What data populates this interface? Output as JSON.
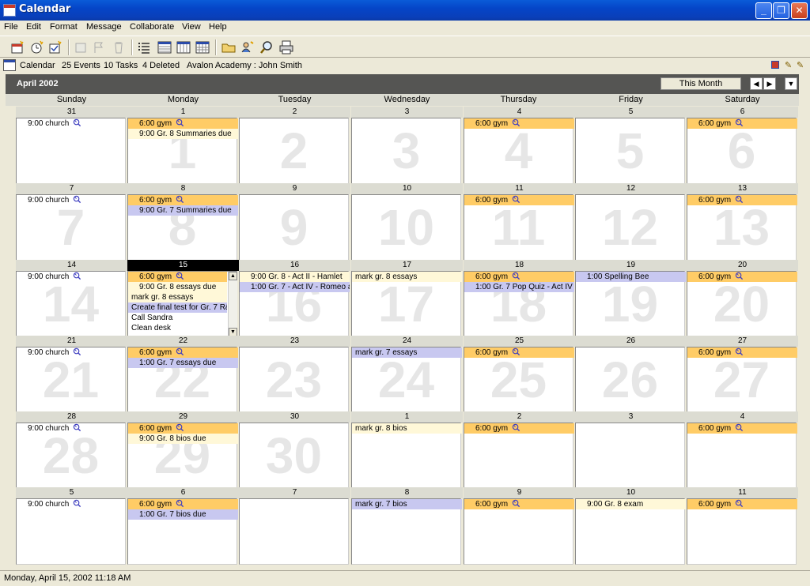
{
  "window": {
    "title": "Calendar",
    "min": "_",
    "max": "❐",
    "close": "✕"
  },
  "menu": [
    "File",
    "Edit",
    "Format",
    "Message",
    "Collaborate",
    "View",
    "Help"
  ],
  "info": {
    "label": "Calendar",
    "events": "25 Events",
    "tasks": "10 Tasks",
    "deleted": "4 Deleted",
    "account": "Avalon Academy : John Smith"
  },
  "month": {
    "title": "April 2002",
    "this_month": "This Month",
    "prev": "◀",
    "next": "▶",
    "dropdown": "▼"
  },
  "day_names": [
    "Sunday",
    "Monday",
    "Tuesday",
    "Wednesday",
    "Thursday",
    "Friday",
    "Saturday"
  ],
  "weeks": [
    [
      {
        "d": "31",
        "big": "",
        "events": [
          {
            "t": "9:00 church",
            "c": "plain",
            "r": true
          }
        ]
      },
      {
        "d": "1",
        "big": "1",
        "events": [
          {
            "t": "6:00 gym",
            "c": "orange",
            "r": true
          },
          {
            "t": "9:00 Gr. 8 Summaries due",
            "c": "yellow"
          }
        ]
      },
      {
        "d": "2",
        "big": "2",
        "events": []
      },
      {
        "d": "3",
        "big": "3",
        "events": []
      },
      {
        "d": "4",
        "big": "4",
        "events": [
          {
            "t": "6:00 gym",
            "c": "orange",
            "r": true
          }
        ]
      },
      {
        "d": "5",
        "big": "5",
        "events": []
      },
      {
        "d": "6",
        "big": "6",
        "events": [
          {
            "t": "6:00 gym",
            "c": "orange",
            "r": true
          }
        ]
      }
    ],
    [
      {
        "d": "7",
        "big": "7",
        "events": [
          {
            "t": "9:00 church",
            "c": "plain",
            "r": true
          }
        ]
      },
      {
        "d": "8",
        "big": "8",
        "events": [
          {
            "t": "6:00 gym",
            "c": "orange",
            "r": true
          },
          {
            "t": "9:00 Gr. 7 Summaries due",
            "c": "purple"
          }
        ]
      },
      {
        "d": "9",
        "big": "9",
        "events": []
      },
      {
        "d": "10",
        "big": "10",
        "events": []
      },
      {
        "d": "11",
        "big": "11",
        "events": [
          {
            "t": "6:00 gym",
            "c": "orange",
            "r": true
          }
        ]
      },
      {
        "d": "12",
        "big": "12",
        "events": []
      },
      {
        "d": "13",
        "big": "13",
        "events": [
          {
            "t": "6:00 gym",
            "c": "orange",
            "r": true
          }
        ]
      }
    ],
    [
      {
        "d": "14",
        "big": "14",
        "events": [
          {
            "t": "9:00 church",
            "c": "plain",
            "r": true
          }
        ]
      },
      {
        "d": "15",
        "big": "",
        "today": true,
        "scroll": true,
        "events": [
          {
            "t": "6:00 gym",
            "c": "orange",
            "r": true
          },
          {
            "t": "9:00 Gr. 8 essays due",
            "c": "yellow"
          },
          {
            "t": "mark gr. 8 essays",
            "c": "yellow",
            "np": true
          },
          {
            "t": "Create final test for Gr. 7 R&",
            "c": "purple",
            "np": true
          },
          {
            "t": "Call Sandra",
            "c": "plain",
            "np": true
          },
          {
            "t": "Clean desk",
            "c": "plain",
            "np": true
          }
        ]
      },
      {
        "d": "16",
        "big": "16",
        "events": [
          {
            "t": "9:00 Gr. 8 - Act II - Hamlet",
            "c": "yellow"
          },
          {
            "t": "1:00 Gr. 7 - Act IV - Romeo a",
            "c": "purple"
          }
        ]
      },
      {
        "d": "17",
        "big": "17",
        "events": [
          {
            "t": "mark gr. 8 essays",
            "c": "yellow",
            "np": true
          }
        ]
      },
      {
        "d": "18",
        "big": "18",
        "events": [
          {
            "t": "6:00 gym",
            "c": "orange",
            "r": true
          },
          {
            "t": "1:00 Gr. 7 Pop Quiz - Act IV -",
            "c": "purple"
          }
        ]
      },
      {
        "d": "19",
        "big": "19",
        "events": [
          {
            "t": "1:00 Spelling Bee",
            "c": "purple"
          }
        ]
      },
      {
        "d": "20",
        "big": "20",
        "events": [
          {
            "t": "6:00 gym",
            "c": "orange",
            "r": true
          }
        ]
      }
    ],
    [
      {
        "d": "21",
        "big": "21",
        "events": [
          {
            "t": "9:00 church",
            "c": "plain",
            "r": true
          }
        ]
      },
      {
        "d": "22",
        "big": "22",
        "events": [
          {
            "t": "6:00 gym",
            "c": "orange",
            "r": true
          },
          {
            "t": "1:00 Gr. 7 essays due",
            "c": "purple"
          }
        ]
      },
      {
        "d": "23",
        "big": "23",
        "events": []
      },
      {
        "d": "24",
        "big": "24",
        "events": [
          {
            "t": "mark gr. 7 essays",
            "c": "purple",
            "np": true
          }
        ]
      },
      {
        "d": "25",
        "big": "25",
        "events": [
          {
            "t": "6:00 gym",
            "c": "orange",
            "r": true
          }
        ]
      },
      {
        "d": "26",
        "big": "26",
        "events": []
      },
      {
        "d": "27",
        "big": "27",
        "events": [
          {
            "t": "6:00 gym",
            "c": "orange",
            "r": true
          }
        ]
      }
    ],
    [
      {
        "d": "28",
        "big": "28",
        "events": [
          {
            "t": "9:00 church",
            "c": "plain",
            "r": true
          }
        ]
      },
      {
        "d": "29",
        "big": "29",
        "events": [
          {
            "t": "6:00 gym",
            "c": "orange",
            "r": true
          },
          {
            "t": "9:00 Gr. 8 bios due",
            "c": "yellow"
          }
        ]
      },
      {
        "d": "30",
        "big": "30",
        "events": []
      },
      {
        "d": "1",
        "big": "",
        "events": [
          {
            "t": "mark gr. 8 bios",
            "c": "yellow",
            "np": true
          }
        ]
      },
      {
        "d": "2",
        "big": "",
        "events": [
          {
            "t": "6:00 gym",
            "c": "orange",
            "r": true
          }
        ]
      },
      {
        "d": "3",
        "big": "",
        "events": []
      },
      {
        "d": "4",
        "big": "",
        "events": [
          {
            "t": "6:00 gym",
            "c": "orange",
            "r": true
          }
        ]
      }
    ],
    [
      {
        "d": "5",
        "big": "",
        "events": [
          {
            "t": "9:00 church",
            "c": "plain",
            "r": true
          }
        ]
      },
      {
        "d": "6",
        "big": "",
        "events": [
          {
            "t": "6:00 gym",
            "c": "orange",
            "r": true
          },
          {
            "t": "1:00 Gr. 7 bios due",
            "c": "purple"
          }
        ]
      },
      {
        "d": "7",
        "big": "",
        "events": []
      },
      {
        "d": "8",
        "big": "",
        "events": [
          {
            "t": "mark gr. 7 bios",
            "c": "purple",
            "np": true
          }
        ]
      },
      {
        "d": "9",
        "big": "",
        "events": [
          {
            "t": "6:00 gym",
            "c": "orange",
            "r": true
          }
        ]
      },
      {
        "d": "10",
        "big": "",
        "events": [
          {
            "t": "9:00 Gr. 8 exam",
            "c": "yellow"
          }
        ]
      },
      {
        "d": "11",
        "big": "",
        "events": [
          {
            "t": "6:00 gym",
            "c": "orange",
            "r": true
          }
        ]
      }
    ]
  ],
  "status": "Monday, April 15, 2002 11:18 AM"
}
